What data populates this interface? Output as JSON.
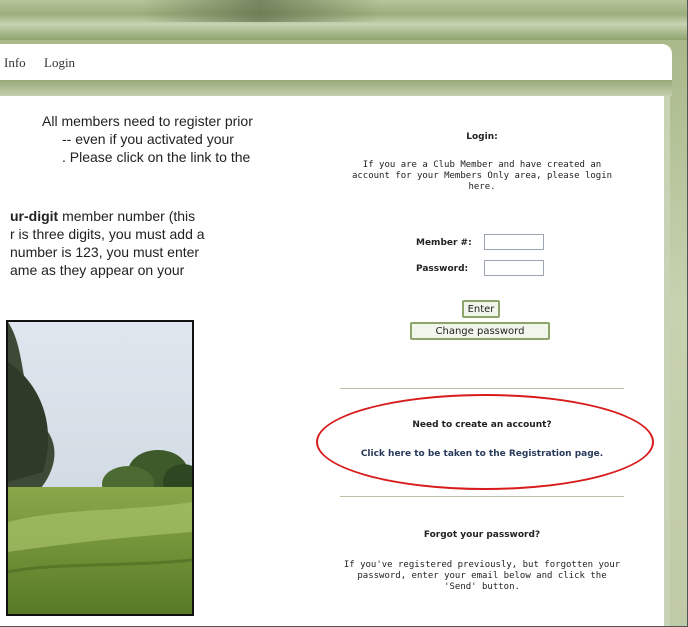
{
  "nav": {
    "items": [
      "Info",
      "Login"
    ]
  },
  "left_text": {
    "para1": [
      "All members need to register prior",
      "-- even if you activated your",
      ". Please click on the link to the"
    ],
    "para2_bold": "ur-digit",
    "para2_first_rest": " member number (this",
    "para2_rest": [
      "r is three digits, you must add a",
      "number is 123, you must enter",
      "ame as they appear on your"
    ]
  },
  "login": {
    "title": "Login:",
    "intro": [
      "If you are a Club Member and have created an",
      "account for your Members Only area, please login",
      "here."
    ],
    "member_label": "Member #:",
    "password_label": "Password:",
    "member_value": "",
    "password_value": "",
    "enter_button": "Enter",
    "change_password_button": "Change password"
  },
  "register": {
    "heading": "Need to create an account?",
    "link": "Click here to be taken to the Registration page."
  },
  "forgot": {
    "heading": "Forgot your password?",
    "text": [
      "If you've registered previously, but forgotten your",
      "password, enter your email below and click the",
      "'Send' button."
    ]
  },
  "colors": {
    "accent_green": "#8da46b",
    "highlight_red": "#d81c1c"
  }
}
